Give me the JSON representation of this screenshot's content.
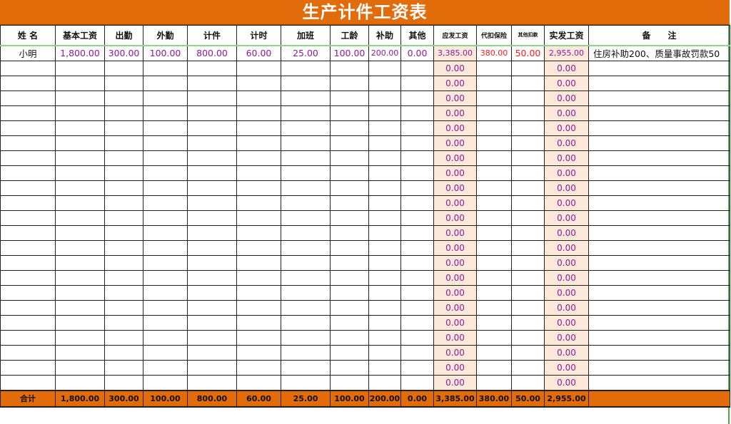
{
  "title": "生产计件工资表",
  "columns": [
    "姓 名",
    "基本工资",
    "出勤",
    "外勤",
    "计件",
    "计时",
    "加班",
    "工龄",
    "补助",
    "其他",
    "应发工资",
    "代扣保险",
    "其他扣款",
    "实发工资",
    "备　　注"
  ],
  "first_row": {
    "name": "小明",
    "basic": "1,800.00",
    "attendance": "300.00",
    "field": "100.00",
    "piece": "800.00",
    "hourly": "60.00",
    "overtime": "25.00",
    "seniority": "100.00",
    "subsidy": "200.00",
    "other": "0.00",
    "gross": "3,385.00",
    "insurance": "380.00",
    "deduction": "50.00",
    "net": "2,955.00",
    "note": "住房补助200、质量事故罚款50"
  },
  "empty_row_gross": "0.00",
  "empty_row_net": "0.00",
  "empty_row_count": 22,
  "totals": {
    "label": "合计",
    "basic": "1,800.00",
    "attendance": "300.00",
    "field": "100.00",
    "piece": "800.00",
    "hourly": "60.00",
    "overtime": "25.00",
    "seniority": "100.00",
    "subsidy": "200.00",
    "other": "0.00",
    "gross": "3,385.00",
    "insurance": "380.00",
    "deduction": "50.00",
    "net": "2,955.00",
    "note": ""
  },
  "colors": {
    "header_orange": "#e26b0a",
    "value_purple": "#8b1a9b",
    "deduction_red": "#ff1a1a",
    "computed_pink": "#fde9d9"
  }
}
